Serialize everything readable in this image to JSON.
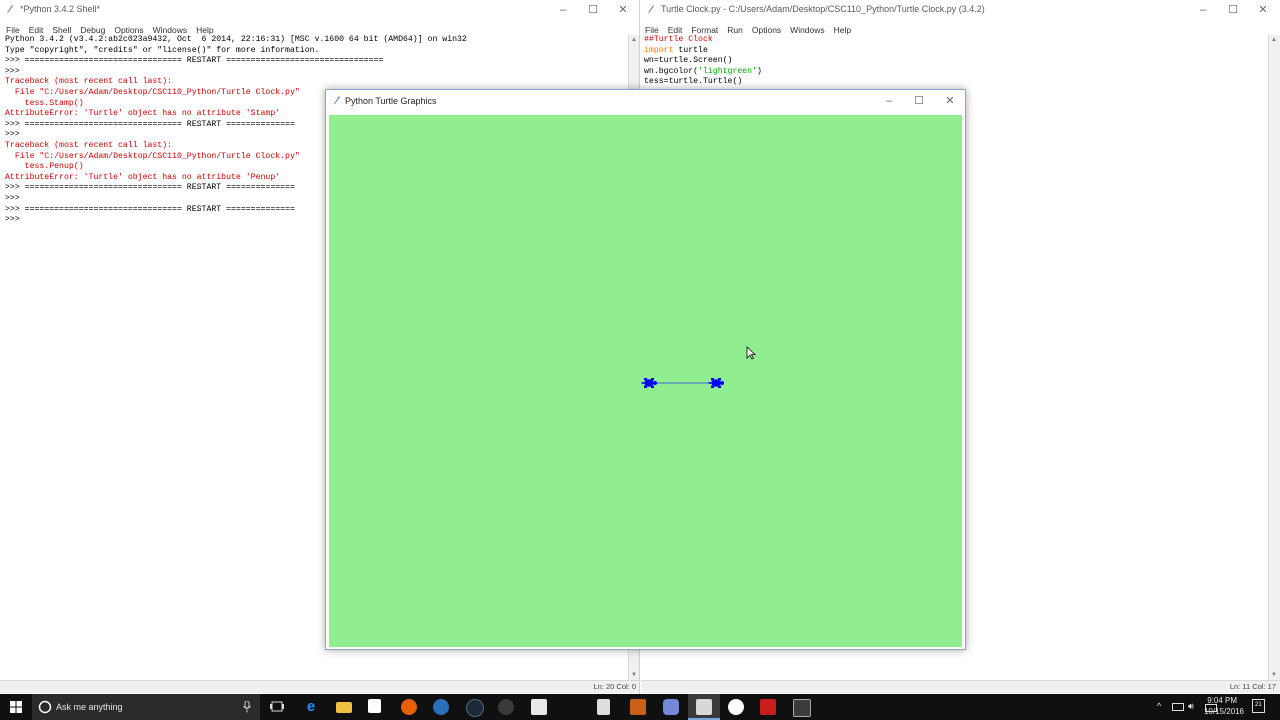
{
  "shell": {
    "title": "*Python 3.4.2 Shell*",
    "menu": [
      "File",
      "Edit",
      "Shell",
      "Debug",
      "Options",
      "Windows",
      "Help"
    ],
    "lines": [
      {
        "t": "Python 3.4.2 (v3.4.2:ab2c023a9432, Oct  6 2014, 22:16:31) [MSC v.1600 64 bit (AMD64)] on win32",
        "c": ""
      },
      {
        "t": "Type \"copyright\", \"credits\" or \"license()\" for more information.",
        "c": ""
      },
      {
        "t": ">>> ================================ RESTART ================================",
        "c": ""
      },
      {
        "t": ">>> ",
        "c": ""
      },
      {
        "t": "Traceback (most recent call last):",
        "c": "red"
      },
      {
        "t": "  File \"C:/Users/Adam/Desktop/CSC110_Python/Turtle Clock.py\"",
        "c": "red"
      },
      {
        "t": "    tess.Stamp()",
        "c": "red"
      },
      {
        "t": "AttributeError: 'Turtle' object has no attribute 'Stamp'",
        "c": "red"
      },
      {
        "t": ">>> ================================ RESTART ==============",
        "c": ""
      },
      {
        "t": ">>> ",
        "c": ""
      },
      {
        "t": "Traceback (most recent call last):",
        "c": "red"
      },
      {
        "t": "  File \"C:/Users/Adam/Desktop/CSC110_Python/Turtle Clock.py\"",
        "c": "red"
      },
      {
        "t": "    tess.Penup()",
        "c": "red"
      },
      {
        "t": "AttributeError: 'Turtle' object has no attribute 'Penup'",
        "c": "red"
      },
      {
        "t": ">>> ================================ RESTART ==============",
        "c": ""
      },
      {
        "t": ">>> ",
        "c": ""
      },
      {
        "t": "",
        "c": ""
      },
      {
        "t": ">>> ================================ RESTART ==============",
        "c": ""
      },
      {
        "t": ">>> ",
        "c": ""
      }
    ],
    "status": "Ln: 20 Col: 0"
  },
  "editor": {
    "title": "Turtle Clock.py - C:/Users/Adam/Desktop/CSC110_Python/Turtle Clock.py (3.4.2)",
    "menu": [
      "File",
      "Edit",
      "Format",
      "Run",
      "Options",
      "Windows",
      "Help"
    ],
    "lines": [
      {
        "parts": [
          {
            "t": "##Turtle Clock",
            "c": "red"
          }
        ]
      },
      {
        "parts": [
          {
            "t": "import",
            "c": "orange"
          },
          {
            "t": " turtle",
            "c": ""
          }
        ]
      },
      {
        "parts": [
          {
            "t": "wn=turtle.Screen()",
            "c": ""
          }
        ]
      },
      {
        "parts": [
          {
            "t": "wn.bgcolor(",
            "c": ""
          },
          {
            "t": "'lightgreen'",
            "c": "green"
          },
          {
            "t": ")",
            "c": ""
          }
        ]
      },
      {
        "parts": [
          {
            "t": "tess=turtle.Turtle()",
            "c": ""
          }
        ]
      }
    ],
    "status": "Ln: 11 Col: 17"
  },
  "turtle_window": {
    "title": "Python Turtle Graphics",
    "bgcolor": "#90ee90",
    "turtle_color": "#0000ff"
  },
  "taskbar": {
    "search_placeholder": "Ask me anything",
    "time": "9:04 PM",
    "date": "10/15/2016",
    "notification_count": "21"
  }
}
